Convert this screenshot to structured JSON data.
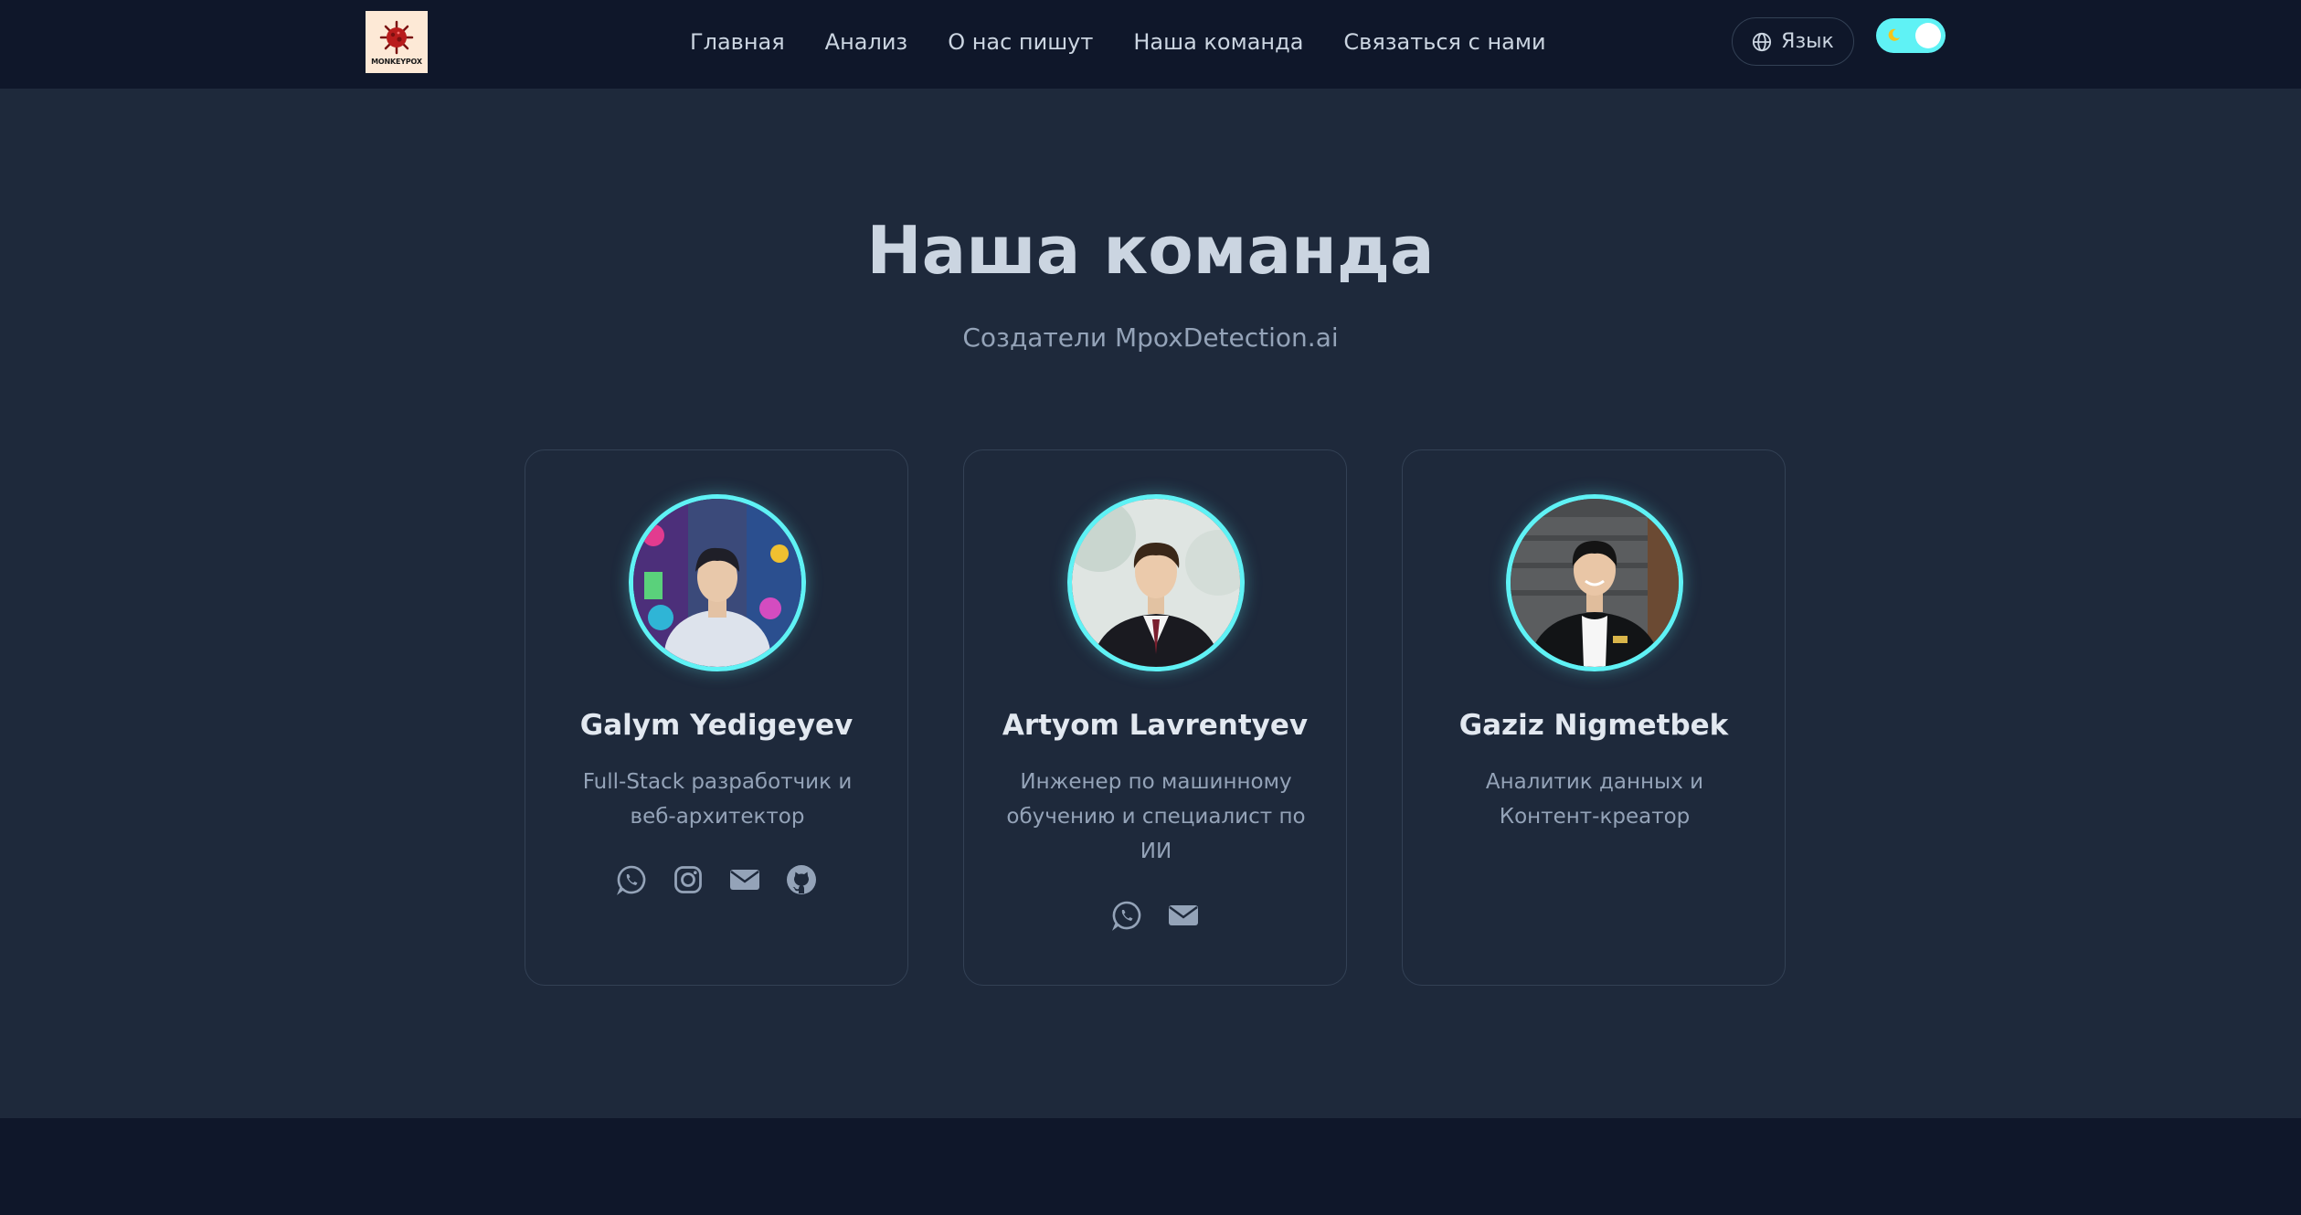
{
  "header": {
    "logo_text": "MONKEYPOX",
    "nav": [
      "Главная",
      "Анализ",
      "О нас пишут",
      "Наша команда",
      "Связаться с нами"
    ],
    "language_label": "Язык",
    "theme_toggle": {
      "state": "dark",
      "accent": "#5ff2f5"
    }
  },
  "section": {
    "title": "Наша команда",
    "subtitle": "Создатели MpoxDetection.ai"
  },
  "team": [
    {
      "name": "Galym Yedigeyev",
      "role": "Full-Stack разработчик и веб-архитектор",
      "socials": [
        "whatsapp-icon",
        "instagram-icon",
        "email-icon",
        "github-icon"
      ]
    },
    {
      "name": "Artyom Lavrentyev",
      "role": "Инженер по машинному обучению и специалист по ИИ",
      "socials": [
        "whatsapp-icon",
        "email-icon"
      ]
    },
    {
      "name": "Gaziz Nigmetbek",
      "role": "Аналитик данных и Контент-креатор",
      "socials": []
    }
  ],
  "colors": {
    "background": "#1e293b",
    "header_bg": "#0f172a",
    "accent": "#5ff2f5",
    "text_muted": "#94a3b8"
  }
}
